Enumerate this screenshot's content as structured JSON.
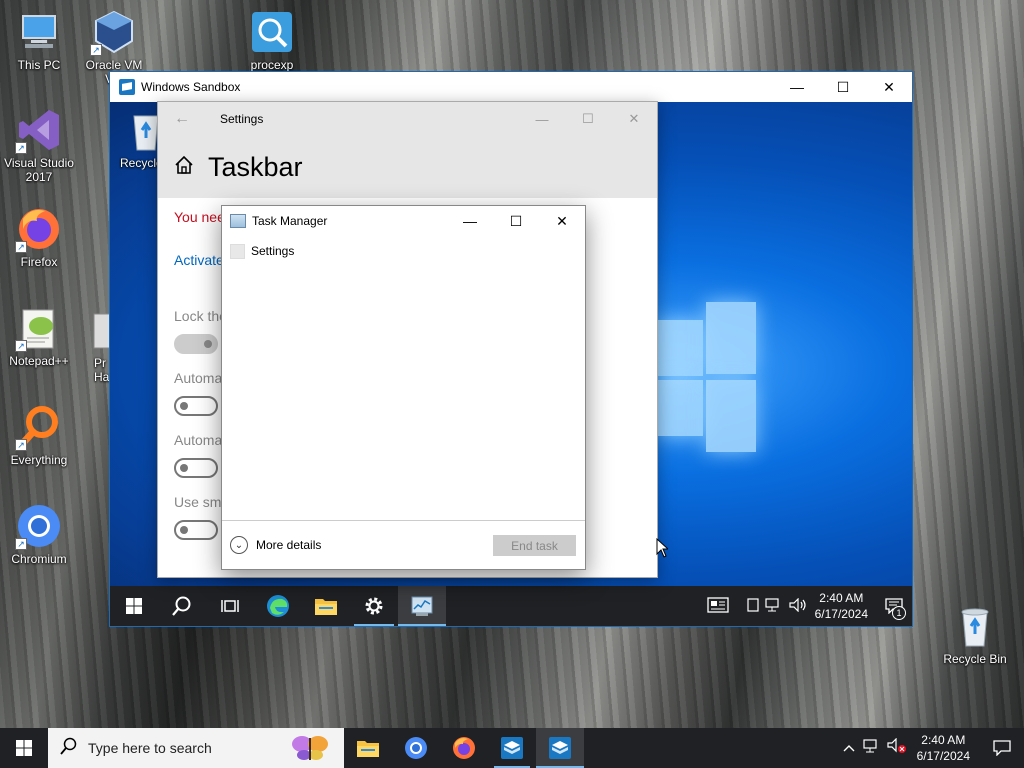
{
  "desktop": {
    "icons": [
      {
        "label": "This PC"
      },
      {
        "label": "Oracle VM Virt"
      },
      {
        "label": "procexp"
      },
      {
        "label": "Visual Studio 2017"
      },
      {
        "label": "Firefox"
      },
      {
        "label": "Notepad++"
      },
      {
        "label": "Pr Ha"
      },
      {
        "label": "Everything"
      },
      {
        "label": "Chromium"
      },
      {
        "label": "Recycle Bin"
      }
    ]
  },
  "sandbox": {
    "title": "Windows Sandbox",
    "desktop_icon_label": "Recycle",
    "settings": {
      "title": "Settings",
      "heading": "Taskbar",
      "warning": "You nee",
      "activate": "Activate",
      "options": [
        {
          "label": "Lock the"
        },
        {
          "label": "Automa"
        },
        {
          "label": "Automa"
        },
        {
          "label": "Use sma"
        }
      ]
    },
    "task_manager": {
      "title": "Task Manager",
      "items": [
        "Settings"
      ],
      "more_details": "More details",
      "end_task": "End task"
    },
    "clock": {
      "time": "2:40 AM",
      "date": "6/17/2024"
    },
    "notification_count": "1"
  },
  "host_taskbar": {
    "search_placeholder": "Type here to search",
    "clock": {
      "time": "2:40 AM",
      "date": "6/17/2024"
    }
  },
  "colors": {
    "accent": "#0067c0",
    "warning": "#c50f1f",
    "taskbar": "#1f2124"
  }
}
